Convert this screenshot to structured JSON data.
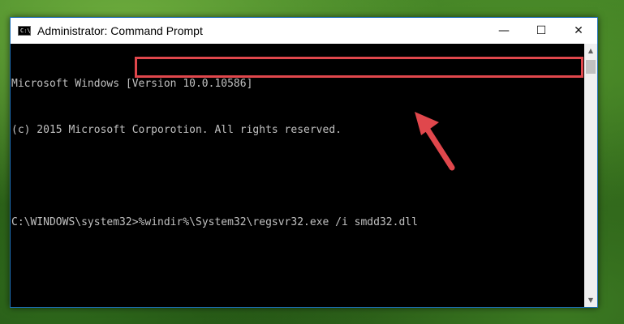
{
  "window": {
    "title": "Administrator: Command Prompt",
    "icon_text": "C:\\",
    "controls": {
      "minimize": "—",
      "maximize": "☐",
      "close": "✕"
    }
  },
  "console": {
    "line1": "Microsoft Windows [Version 10.0.10586]",
    "line2": "(c) 2015 Microsoft Corporotion. All rights reserved.",
    "prompt": "C:\\WINDOWS\\system32>",
    "command": "%windir%\\System32\\regsvr32.exe /i smdd32.dll"
  },
  "colors": {
    "highlight": "#e0474c",
    "arrow": "#e0474c"
  },
  "icons": [
    "cmd-icon",
    "minimize-icon",
    "maximize-icon",
    "close-icon",
    "annotation-arrow-icon"
  ]
}
